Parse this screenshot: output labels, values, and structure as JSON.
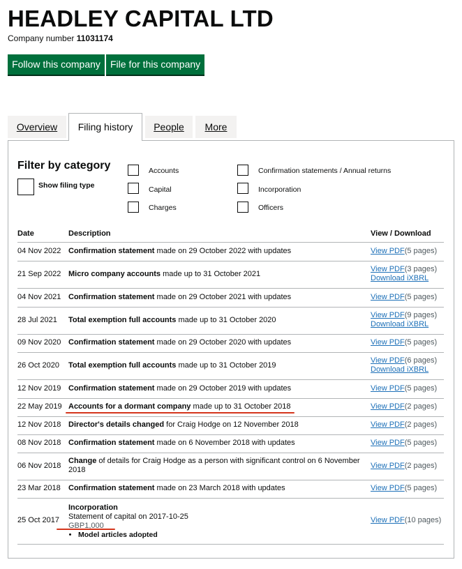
{
  "company": {
    "name": "HEADLEY CAPITAL LTD",
    "number_label": "Company number",
    "number": "11031174"
  },
  "buttons": {
    "follow": "Follow this company",
    "file": "File for this company"
  },
  "tabs": [
    {
      "label": "Overview",
      "active": false
    },
    {
      "label": "Filing history",
      "active": true
    },
    {
      "label": "People",
      "active": false
    },
    {
      "label": "More",
      "active": false
    }
  ],
  "filter": {
    "title": "Filter by category",
    "show_filing_type": "Show filing type",
    "categories": [
      "Accounts",
      "Capital",
      "Charges",
      "Confirmation statements / Annual returns",
      "Incorporation",
      "Officers"
    ]
  },
  "table": {
    "headers": {
      "date": "Date",
      "description": "Description",
      "view": "View / Download"
    },
    "view_pdf": "View PDF",
    "download_ixbrl": "Download iXBRL",
    "rows": [
      {
        "date": "04 Nov 2022",
        "bold": "Confirmation statement",
        "rest": " made on 29 October 2022 with updates",
        "pages": "(5 pages)",
        "ixbrl": false
      },
      {
        "date": "21 Sep 2022",
        "bold": "Micro company accounts",
        "rest": " made up to 31 October 2021",
        "pages": "(3 pages)",
        "ixbrl": true
      },
      {
        "date": "04 Nov 2021",
        "bold": "Confirmation statement",
        "rest": " made on 29 October 2021 with updates",
        "pages": "(5 pages)",
        "ixbrl": false
      },
      {
        "date": "28 Jul 2021",
        "bold": "Total exemption full accounts",
        "rest": " made up to 31 October 2020",
        "pages": "(9 pages)",
        "ixbrl": true
      },
      {
        "date": "09 Nov 2020",
        "bold": "Confirmation statement",
        "rest": " made on 29 October 2020 with updates",
        "pages": "(5 pages)",
        "ixbrl": false
      },
      {
        "date": "26 Oct 2020",
        "bold": "Total exemption full accounts",
        "rest": " made up to 31 October 2019",
        "pages": "(6 pages)",
        "ixbrl": true
      },
      {
        "date": "12 Nov 2019",
        "bold": "Confirmation statement",
        "rest": " made on 29 October 2019 with updates",
        "pages": "(5 pages)",
        "ixbrl": false
      },
      {
        "date": "22 May 2019",
        "bold": "Accounts for a dormant company",
        "rest": " made up to 31 October 2018",
        "pages": "(2 pages)",
        "ixbrl": false
      },
      {
        "date": "12 Nov 2018",
        "bold": "Director's details changed",
        "rest": " for Craig Hodge on 12 November 2018",
        "pages": "(2 pages)",
        "ixbrl": false
      },
      {
        "date": "08 Nov 2018",
        "bold": "Confirmation statement",
        "rest": " made on 6 November 2018 with updates",
        "pages": "(5 pages)",
        "ixbrl": false
      },
      {
        "date": "06 Nov 2018",
        "bold": "Change",
        "rest": " of details for Craig Hodge as a person with significant control on 6 November 2018",
        "pages": "(2 pages)",
        "ixbrl": false
      },
      {
        "date": "23 Mar 2018",
        "bold": "Confirmation statement",
        "rest": " made on 23 March 2018 with updates",
        "pages": "(5 pages)",
        "ixbrl": false
      }
    ],
    "incorporation": {
      "date": "25 Oct 2017",
      "title": "Incorporation",
      "statement": "Statement of capital on 2017-10-25",
      "capital": "GBP1,000",
      "bullet": "Model articles adopted",
      "pages": "(10 pages)"
    }
  },
  "highlight_color": "#d4351c"
}
